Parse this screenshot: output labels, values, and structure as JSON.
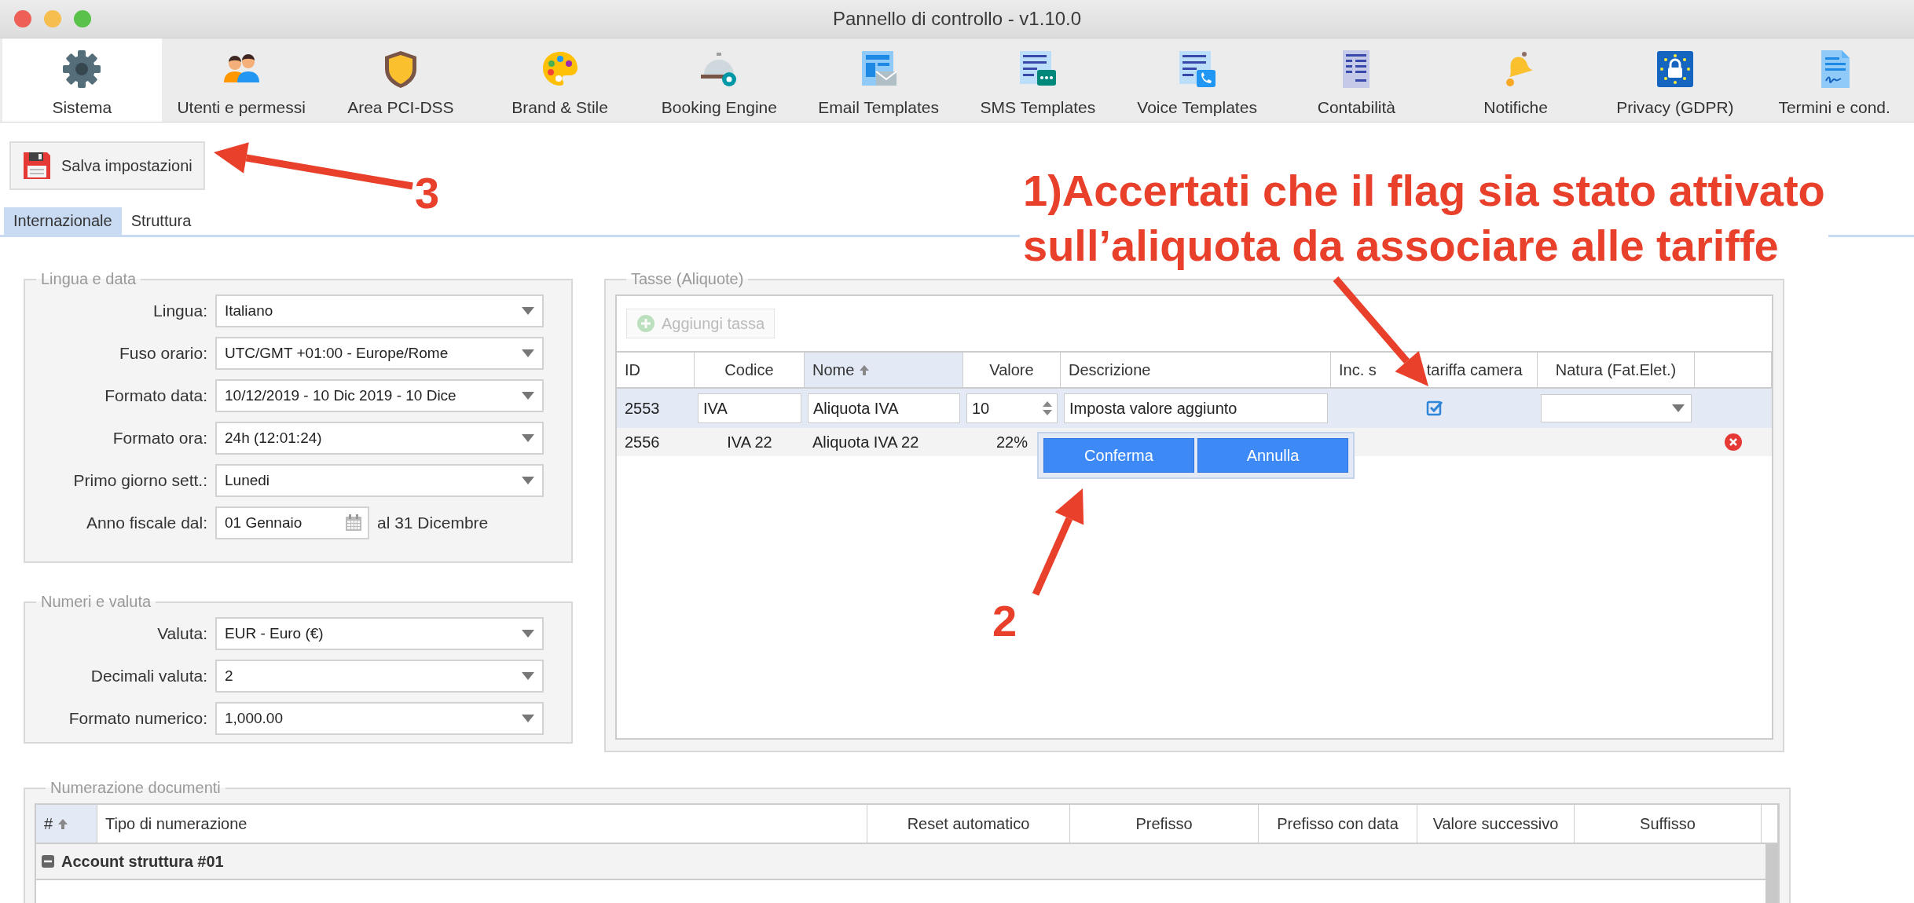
{
  "window": {
    "title": "Pannello di controllo - v1.10.0"
  },
  "toolbar": {
    "tabs": [
      {
        "label": "Sistema",
        "selected": true
      },
      {
        "label": "Utenti e permessi",
        "selected": false
      },
      {
        "label": "Area PCI-DSS",
        "selected": false
      },
      {
        "label": "Brand & Stile",
        "selected": false
      },
      {
        "label": "Booking Engine",
        "selected": false
      },
      {
        "label": "Email Templates",
        "selected": false
      },
      {
        "label": "SMS Templates",
        "selected": false
      },
      {
        "label": "Voice Templates",
        "selected": false
      },
      {
        "label": "Contabilità",
        "selected": false
      },
      {
        "label": "Notifiche",
        "selected": false
      },
      {
        "label": "Privacy (GDPR)",
        "selected": false
      },
      {
        "label": "Termini e cond.",
        "selected": false
      }
    ]
  },
  "save_button": {
    "label": "Salva impostazioni"
  },
  "subtabs": [
    {
      "label": "Internazionale",
      "selected": true
    },
    {
      "label": "Struttura",
      "selected": false
    }
  ],
  "lingua_e_data": {
    "title": "Lingua e data",
    "fields": [
      {
        "kind": "select",
        "label": "Lingua:",
        "value": "Italiano"
      },
      {
        "kind": "select",
        "label": "Fuso orario:",
        "value": "UTC/GMT +01:00 - Europe/Rome"
      },
      {
        "kind": "select",
        "label": "Formato data:",
        "value": "10/12/2019 - 10 Dic 2019 - 10 Dice"
      },
      {
        "kind": "select",
        "label": "Formato ora:",
        "value": "24h (12:01:24)"
      },
      {
        "kind": "select",
        "label": "Primo giorno sett.:",
        "value": "Lunedi"
      },
      {
        "kind": "date",
        "label": "Anno fiscale dal:",
        "value": "01 Gennaio",
        "suffix": "al 31 Dicembre"
      }
    ]
  },
  "numeri_e_valuta": {
    "title": "Numeri e valuta",
    "fields": [
      {
        "kind": "select",
        "label": "Valuta:",
        "value": "EUR - Euro (€)"
      },
      {
        "kind": "select",
        "label": "Decimali valuta:",
        "value": "2"
      },
      {
        "kind": "select",
        "label": "Formato numerico:",
        "value": "1,000.00"
      }
    ]
  },
  "tasse": {
    "title": "Tasse (Aliquote)",
    "add_button": {
      "label": "Aggiungi tassa",
      "disabled": true
    },
    "columns": [
      {
        "label": "ID",
        "sorted": false
      },
      {
        "label": "Codice",
        "sorted": false
      },
      {
        "label": "Nome",
        "sorted": true
      },
      {
        "label": "Valore",
        "sorted": false
      },
      {
        "label": "Descrizione",
        "sorted": false
      },
      {
        "label": "Inc. s",
        "label_after": "tariffa camera",
        "sorted": false
      },
      {
        "label": "Natura (Fat.Elet.)",
        "sorted": false
      }
    ],
    "rows": [
      {
        "editing": true,
        "selected": true,
        "id": "2553",
        "codice": "IVA",
        "nome": "Aliquota IVA",
        "valore": "10",
        "descrizione": "Imposta valore aggiunto",
        "inc_tariffa": true
      },
      {
        "editing": false,
        "selected": false,
        "id": "2556",
        "codice": "IVA 22",
        "nome": "Aliquota IVA 22",
        "valore": "22%",
        "inc_tariffa": false
      }
    ],
    "confirm": {
      "buttons": [
        "Conferma",
        "Annulla"
      ]
    }
  },
  "numerazione": {
    "title": "Numerazione documenti",
    "columns": [
      {
        "label": "#",
        "sorted": true
      },
      {
        "label": "Tipo di numerazione",
        "sorted": false
      },
      {
        "label": "Reset automatico",
        "sorted": false
      },
      {
        "label": "Prefisso",
        "sorted": false
      },
      {
        "label": "Prefisso con data",
        "sorted": false
      },
      {
        "label": "Valore successivo",
        "sorted": false
      },
      {
        "label": "Suffisso",
        "sorted": false
      }
    ],
    "groups": [
      {
        "label": "Account struttura #01",
        "expanded": true
      }
    ]
  },
  "annotations": [
    {
      "kind": "step",
      "text": "3"
    },
    {
      "kind": "note",
      "text": "1)Accertati che il flag sia stato attivato\nsull’aliquota da associare alle tariffe"
    },
    {
      "kind": "step",
      "text": "2"
    }
  ]
}
